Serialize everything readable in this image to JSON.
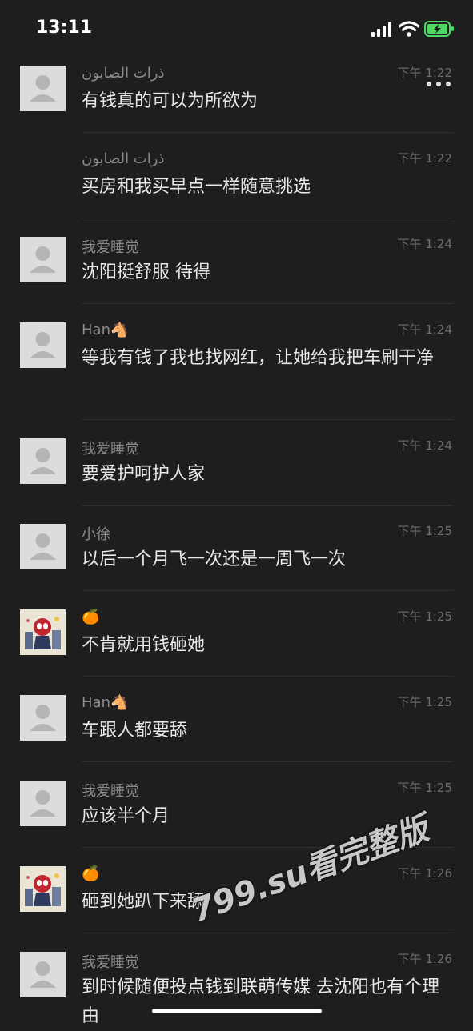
{
  "status": {
    "time": "13:11"
  },
  "messages": [
    {
      "sender": "ذرات الصابون",
      "time": "下午 1:22",
      "text": "有钱真的可以为所欲为",
      "avatar": "default"
    },
    {
      "sender": "ذرات الصابون",
      "time": "下午 1:22",
      "text": "买房和我买早点一样随意挑选",
      "avatar": "none"
    },
    {
      "sender": "我爱睡觉",
      "time": "下午 1:24",
      "text": "沈阳挺舒服 待得",
      "avatar": "default"
    },
    {
      "sender": "Han🐴",
      "time": "下午 1:24",
      "text": "等我有钱了我也找网红，让她给我把车刷干净",
      "avatar": "default"
    },
    {
      "sender": "我爱睡觉",
      "time": "下午 1:24",
      "text": "要爱护呵护人家",
      "avatar": "default"
    },
    {
      "sender": "小徐",
      "time": "下午 1:25",
      "text": "以后一个月飞一次还是一周飞一次",
      "avatar": "default"
    },
    {
      "sender": "🍊",
      "time": "下午 1:25",
      "text": "不肯就用钱砸她",
      "avatar": "custom"
    },
    {
      "sender": "Han🐴",
      "time": "下午 1:25",
      "text": "车跟人都要舔",
      "avatar": "default"
    },
    {
      "sender": "我爱睡觉",
      "time": "下午 1:25",
      "text": "应该半个月",
      "avatar": "default"
    },
    {
      "sender": "🍊",
      "time": "下午 1:26",
      "text": "砸到她趴下来舔",
      "avatar": "custom"
    },
    {
      "sender": "我爱睡觉",
      "time": "下午 1:26",
      "text": "到时候随便投点钱到联萌传媒 去沈阳也有个理由",
      "avatar": "default"
    }
  ],
  "watermark": "799.su看完整版",
  "icons": {
    "back": "chevron-left-icon",
    "more": "more-icon",
    "avatar_default": "person-icon",
    "signal": "signal-icon",
    "wifi": "wifi-icon",
    "battery": "battery-icon"
  },
  "colors": {
    "background": "#1e1e1e",
    "text": "#e8e8e8",
    "sender": "#8a8a8a",
    "timestamp": "#6e6e6e",
    "battery": "#4cd964"
  }
}
